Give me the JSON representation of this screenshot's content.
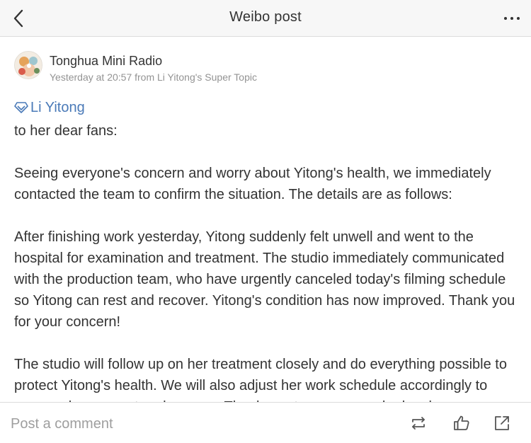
{
  "header": {
    "title": "Weibo post",
    "back_icon": "chevron-left-icon",
    "more_icon": "more-dots-icon"
  },
  "author": {
    "name": "Tonghua Mini Radio",
    "meta": "Yesterday at 20:57 from Li Yitong's Super Topic"
  },
  "post": {
    "mention": "Li Yitong",
    "mention_icon": "super-topic-diamond-icon",
    "mention_color": "#4a7ab8",
    "paragraphs": [
      "to her dear fans:",
      "Seeing everyone's concern and worry about Yitong's health, we immediately contacted the team to confirm the situation. The details are as follows:",
      "After finishing work yesterday, Yitong suddenly felt unwell and went to the hospital for examination and treatment. The studio immediately communicated with the production team, who have urgently canceled today's filming schedule so Yitong can rest and recover. Yitong's condition has now improved. Thank you for your concern!",
      "The studio will follow up on her treatment closely and do everything possible to protect Yitong's health. We will also adjust her work schedule accordingly to ensure she can rest and recover. Thank you to everyone who has been concerned and supportive."
    ]
  },
  "bottom": {
    "comment_placeholder": "Post a comment",
    "icons": [
      "repost-icon",
      "like-icon",
      "share-icon"
    ]
  }
}
